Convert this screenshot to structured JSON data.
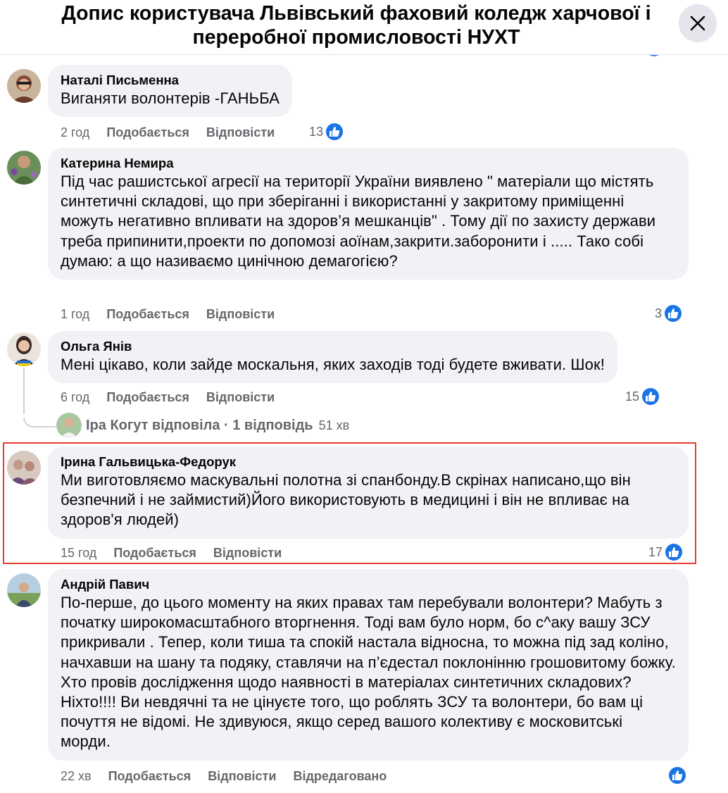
{
  "header": {
    "title": "Допис користувача Львівський фаховий коледж харчової і переробної промисловості НУХТ"
  },
  "comments": [
    {
      "author": "Наталі Письменна",
      "text": "Виганяти волонтерів -ГАНЬБА",
      "time": "2 год",
      "like_label": "Подобається",
      "reply_label": "Відповісти",
      "reactions": "13"
    },
    {
      "author": "Катерина Немира",
      "text": "Під час рашистської агресії на території України виявлено \" матеріали що містять синтетичні складові, що при зберіганні і використанні у закритому приміщенні можуть негативно впливати на здоров’я мешканців\" . Тому дії по захисту держави треба припинити,проекти по допомозі аоїнам,закрити.заборонити і ..... Тако собі думаю: а що називаємо цинічною демагогією?",
      "time": "1 год",
      "like_label": "Подобається",
      "reply_label": "Відповісти",
      "reactions": "3"
    },
    {
      "author": "Ольга Янів",
      "text": "Мені цікаво, коли зайде москальня, яких заходів тоді будете вживати. Шок!",
      "time": "6 год",
      "like_label": "Подобається",
      "reply_label": "Відповісти",
      "reactions": "15",
      "replies": {
        "text": "Іра Когут відповіла · 1 відповідь",
        "time": "51 хв"
      }
    },
    {
      "author": "Ірина Гальвицька-Федорук",
      "text": "Ми виготовляємо маскувальні полотна зі спанбонду.В скрінах написано,що він безпечний і не займистий)Його використовують в медицині і він не впливає на здоров'я людей)",
      "time": "15 год",
      "like_label": "Подобається",
      "reply_label": "Відповісти",
      "reactions": "17"
    },
    {
      "author": "Андрій Павич",
      "text": "По-перше, до цього моменту на яких правах там перебували волонтери? Мабуть з початку широкомасштабного вторгнення. Тоді вам було норм, бо с^аку вашу ЗСУ прикривали . Тепер, коли тиша та спокій настала відносна, то можна під зад коліно, начхавши на шану та подяку, ставлячи на п’єдестал поклонінню грошовитому божку. Хто провів дослідження щодо наявності в матеріалах синтетичних складових? Ніхто!!!! Ви невдячні та не цінуєте того, що роблять ЗСУ та волонтери, бо вам ці почуття не відомі. Не здивуюся, якщо серед вашого колективу є московитські морди.",
      "time": "22 хв",
      "like_label": "Подобається",
      "reply_label": "Відповісти",
      "edited_label": "Відредаговано"
    }
  ],
  "icons": {
    "close": "close-icon",
    "like": "thumbs-up-icon"
  },
  "colors": {
    "accent": "#1b74e4",
    "bubble": "#f0f2f5",
    "secondary_text": "#65676b",
    "highlight": "#e53e30"
  }
}
